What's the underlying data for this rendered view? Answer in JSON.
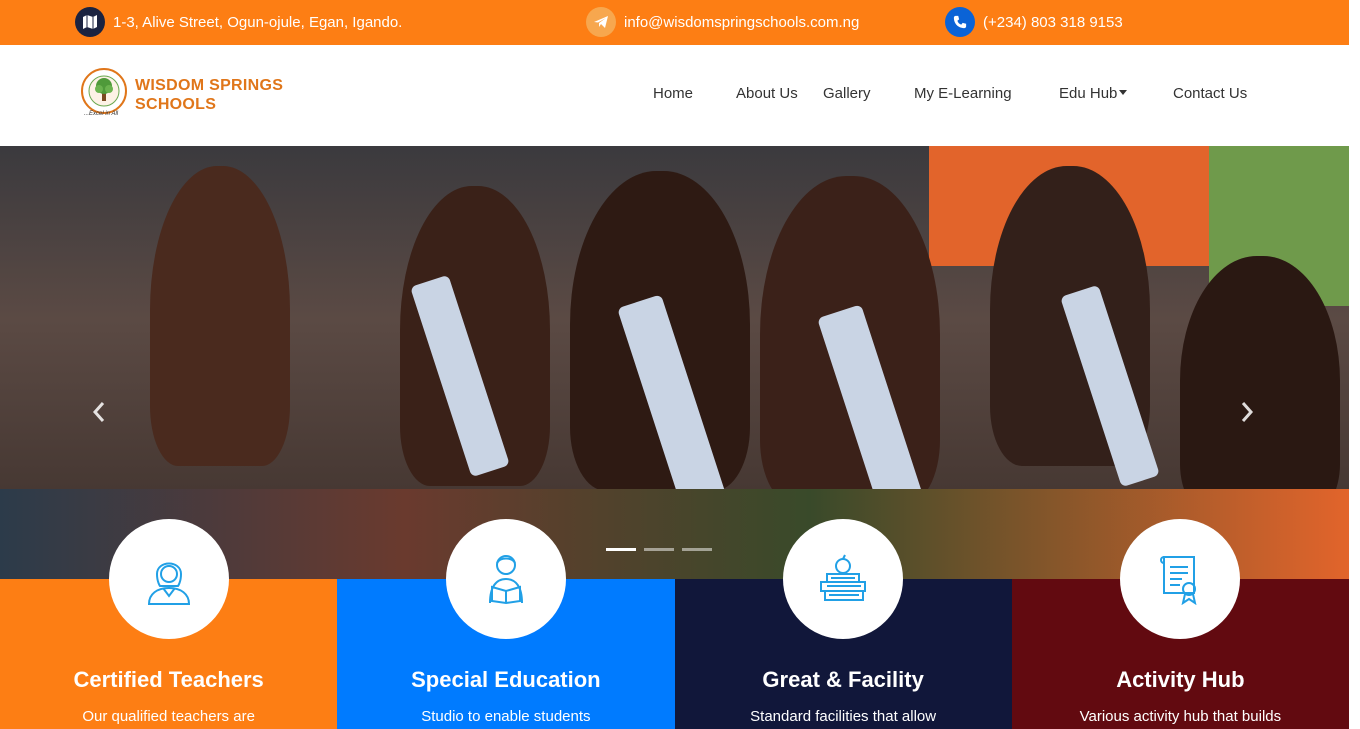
{
  "topbar": {
    "address": "1-3, Alive Street, Ogun-ojule, Egan, Igando.",
    "email": "info@wisdomspringschools.com.ng",
    "phone": "(+234) 803 318 9153",
    "icons": [
      "map-icon",
      "telegram-icon",
      "phone-icon"
    ]
  },
  "brand": {
    "line1": "WISDOM SPRINGS",
    "line2": "SCHOOLS",
    "tagline": "...Excel in All",
    "color": "#e0761a"
  },
  "nav": {
    "home": "Home",
    "about": "About Us",
    "gallery": "Gallery",
    "elearning": "My E-Learning",
    "eduhub": "Edu Hub",
    "contact": "Contact Us"
  },
  "hero": {
    "prev_icon": "chevron-left-icon",
    "next_icon": "chevron-right-icon",
    "indicators": 3,
    "active_indicator": 1
  },
  "features": [
    {
      "title": "Certified Teachers",
      "text": "Our qualified teachers are",
      "color": "#fd7e14",
      "icon": "teacher-icon"
    },
    {
      "title": "Special Education",
      "text": "Studio to enable students",
      "color": "#007bff",
      "icon": "student-reading-icon"
    },
    {
      "title": "Great & Facility",
      "text": "Standard facilities that allow",
      "color": "#11173a",
      "icon": "books-apple-icon"
    },
    {
      "title": "Activity Hub",
      "text": "Various activity hub that builds",
      "color": "#620a10",
      "icon": "certificate-icon"
    }
  ],
  "colors": {
    "topbar": "#fd7e14",
    "icon_blue": "#21a0e6"
  }
}
